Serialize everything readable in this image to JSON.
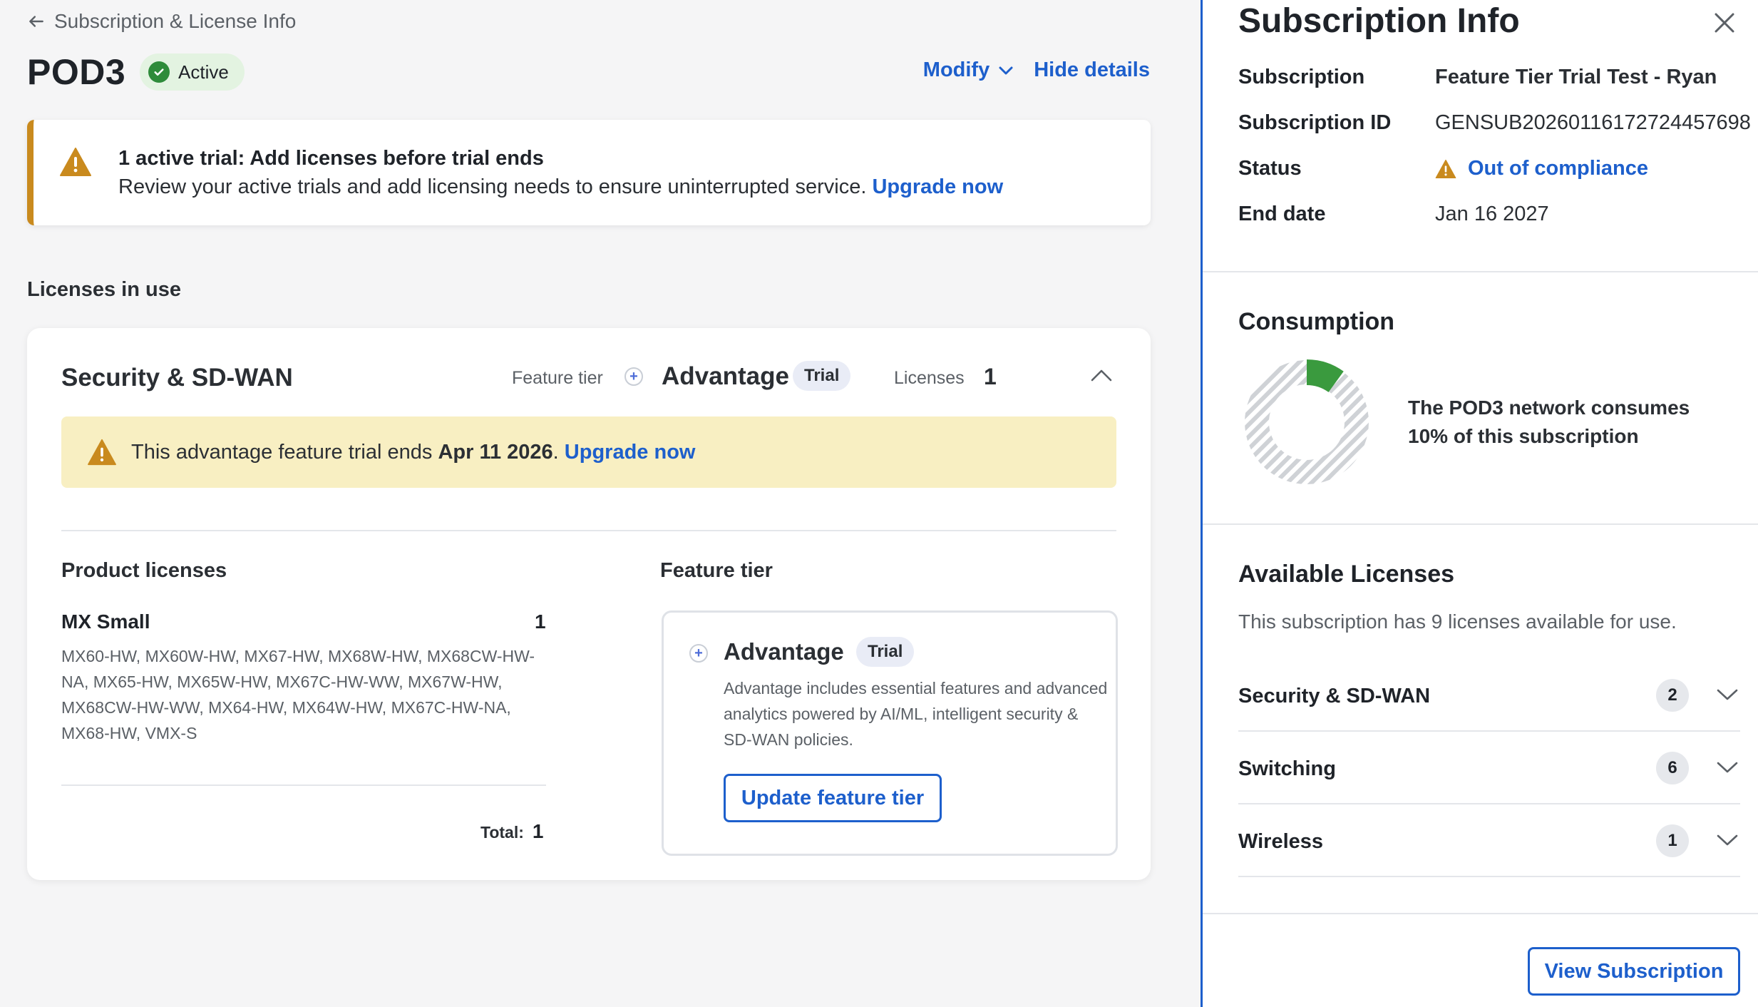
{
  "breadcrumb": {
    "label": "Subscription & License Info"
  },
  "network": {
    "name": "POD3",
    "status": "Active"
  },
  "header_actions": {
    "modify": "Modify",
    "hide_details": "Hide details"
  },
  "trial_banner": {
    "title": "1 active trial: Add licenses before trial ends",
    "body": "Review your active trials and add licensing needs to ensure uninterrupted service.",
    "link": "Upgrade now"
  },
  "licenses_in_use": {
    "label": "Licenses in use",
    "card": {
      "title": "Security & SD-WAN",
      "feature_tier_label": "Feature tier",
      "tier": "Advantage",
      "tier_badge": "Trial",
      "licenses_label": "Licenses",
      "licenses_count": "1",
      "notice": {
        "prefix": "This advantage feature trial ends",
        "date": "Apr 11 2026",
        "suffix": ".",
        "link": "Upgrade now"
      },
      "product_licenses_label": "Product licenses",
      "product": {
        "name": "MX Small",
        "count": "1",
        "models": "MX60-HW, MX60W-HW, MX67-HW, MX68W-HW, MX68CW-HW-NA, MX65-HW, MX65W-HW, MX67C-HW-WW, MX67W-HW, MX68CW-HW-WW, MX64-HW, MX64W-HW, MX67C-HW-NA, MX68-HW, VMX-S"
      },
      "total_label": "Total:",
      "total_value": "1",
      "feature_tier_section_label": "Feature tier",
      "feature_tier_box": {
        "name": "Advantage",
        "badge": "Trial",
        "description": "Advantage includes essential features and advanced analytics powered by AI/ML, intelligent security & SD-WAN policies.",
        "button": "Update feature tier"
      }
    }
  },
  "panel": {
    "title": "Subscription Info",
    "rows": {
      "subscription": {
        "label": "Subscription",
        "value": "Feature Tier Trial Test - Ryan"
      },
      "subscription_id": {
        "label": "Subscription ID",
        "value": "GENSUB20260116172724457698"
      },
      "status": {
        "label": "Status",
        "value": "Out of compliance"
      },
      "end_date": {
        "label": "End date",
        "value": "Jan 16 2027"
      }
    },
    "consumption": {
      "title": "Consumption",
      "percent": 10,
      "text": "The POD3 network consumes 10% of this subscription"
    },
    "available": {
      "title": "Available Licenses",
      "description": "This subscription has 9 licenses available for use.",
      "items": [
        {
          "name": "Security & SD-WAN",
          "count": "2"
        },
        {
          "name": "Switching",
          "count": "6"
        },
        {
          "name": "Wireless",
          "count": "1"
        }
      ]
    },
    "view_button": "View Subscription"
  },
  "colors": {
    "link": "#1d5fcc",
    "warning": "#c98a1e",
    "active_badge_bg": "#e3f3e1",
    "active_check": "#2e8b3a",
    "notice_bg": "#f8efc2",
    "consumption_fill": "#3a9a3e"
  },
  "icons": {
    "back": "arrow-left-icon",
    "check": "check-circle-icon",
    "warning": "warning-triangle-icon",
    "plus": "plus-circle-icon",
    "collapse": "chevron-up-icon",
    "expand": "chevron-down-icon",
    "close": "close-icon"
  }
}
